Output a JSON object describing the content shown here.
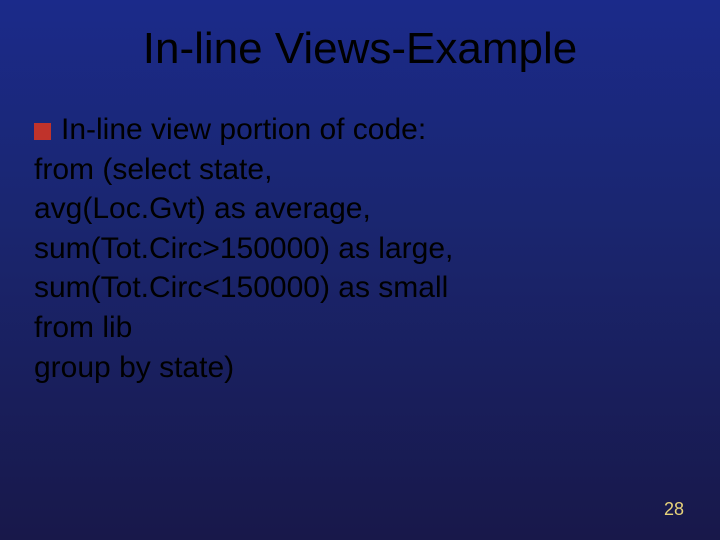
{
  "slide": {
    "title": "In-line Views-Example",
    "bullet_lead": "In-line view portion of code:",
    "code_lines": [
      "from (select state,",
      "avg(Loc.Gvt) as average,",
      "sum(Tot.Circ>150000) as large,",
      "sum(Tot.Circ<150000) as small",
      "from lib",
      "group by state)"
    ],
    "page_number": "28"
  }
}
